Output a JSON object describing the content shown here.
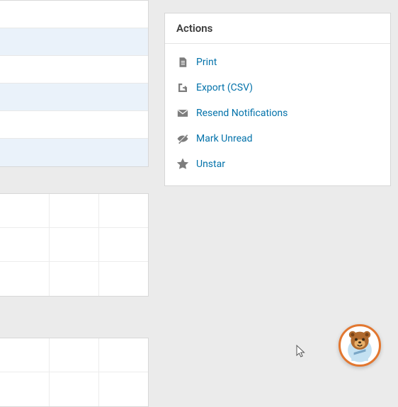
{
  "actions": {
    "title": "Actions",
    "items": [
      {
        "id": "print",
        "label": "Print",
        "icon": "file-icon"
      },
      {
        "id": "export",
        "label": "Export (CSV)",
        "icon": "export-icon"
      },
      {
        "id": "resend",
        "label": "Resend Notifications",
        "icon": "mail-icon"
      },
      {
        "id": "unread",
        "label": "Mark Unread",
        "icon": "eye-off-icon"
      },
      {
        "id": "unstar",
        "label": "Unstar",
        "icon": "star-icon"
      }
    ]
  },
  "colors": {
    "link": "#0372aa",
    "icon": "#7d7d7d",
    "accent": "#e27730"
  }
}
